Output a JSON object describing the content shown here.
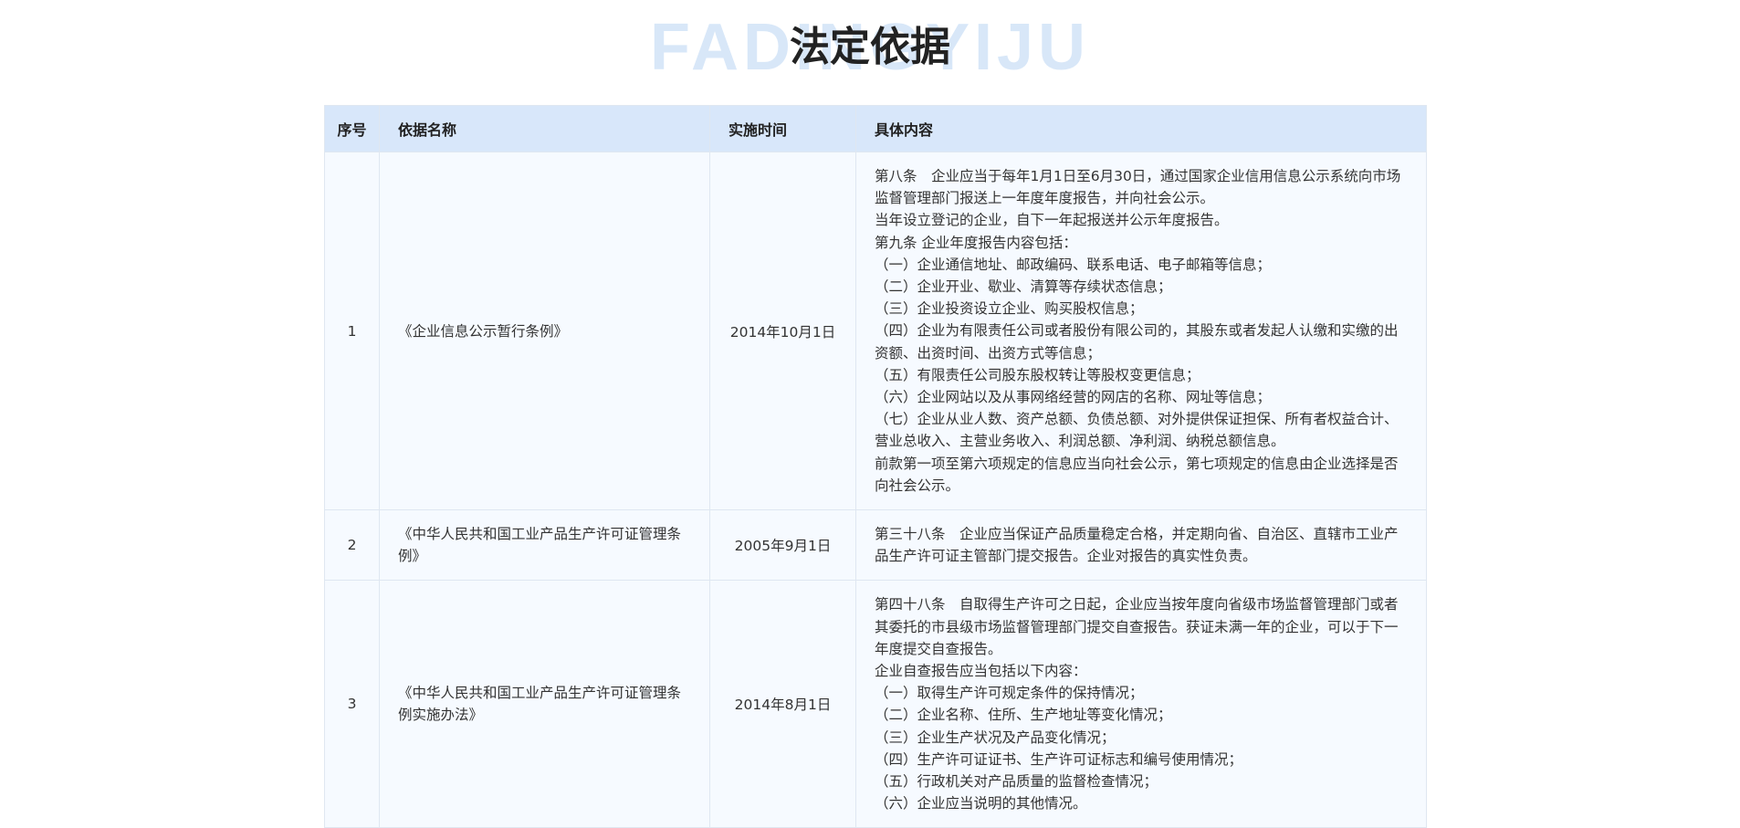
{
  "header": {
    "watermark": "FADINGYIJU",
    "title": "法定依据"
  },
  "table": {
    "columns": [
      "序号",
      "依据名称",
      "实施时间",
      "具体内容"
    ],
    "rows": [
      {
        "no": "1",
        "name": "《企业信息公示暂行条例》",
        "date": "2014年10月1日",
        "content": [
          "第八条　企业应当于每年1月1日至6月30日，通过国家企业信用信息公示系统向市场监督管理部门报送上一年度年度报告，并向社会公示。",
          "当年设立登记的企业，自下一年起报送并公示年度报告。",
          "第九条 企业年度报告内容包括：",
          "（一）企业通信地址、邮政编码、联系电话、电子邮箱等信息；",
          "（二）企业开业、歇业、清算等存续状态信息；",
          "（三）企业投资设立企业、购买股权信息；",
          "（四）企业为有限责任公司或者股份有限公司的，其股东或者发起人认缴和实缴的出资额、出资时间、出资方式等信息；",
          "（五）有限责任公司股东股权转让等股权变更信息；",
          "（六）企业网站以及从事网络经营的网店的名称、网址等信息；",
          "（七）企业从业人数、资产总额、负债总额、对外提供保证担保、所有者权益合计、营业总收入、主营业务收入、利润总额、净利润、纳税总额信息。",
          "前款第一项至第六项规定的信息应当向社会公示，第七项规定的信息由企业选择是否向社会公示。"
        ]
      },
      {
        "no": "2",
        "name": "《中华人民共和国工业产品生产许可证管理条例》",
        "date": "2005年9月1日",
        "content": [
          "第三十八条　企业应当保证产品质量稳定合格，并定期向省、自治区、直辖市工业产品生产许可证主管部门提交报告。企业对报告的真实性负责。"
        ]
      },
      {
        "no": "3",
        "name": "《中华人民共和国工业产品生产许可证管理条例实施办法》",
        "date": "2014年8月1日",
        "content": [
          "第四十八条　自取得生产许可之日起，企业应当按年度向省级市场监督管理部门或者其委托的市县级市场监督管理部门提交自查报告。获证未满一年的企业，可以于下一年度提交自查报告。",
          "企业自查报告应当包括以下内容：",
          "（一）取得生产许可规定条件的保持情况；",
          "（二）企业名称、住所、生产地址等变化情况；",
          "（三）企业生产状况及产品变化情况；",
          "（四）生产许可证证书、生产许可证标志和编号使用情况；",
          "（五）行政机关对产品质量的监督检查情况；",
          "（六）企业应当说明的其他情况。"
        ]
      }
    ]
  }
}
